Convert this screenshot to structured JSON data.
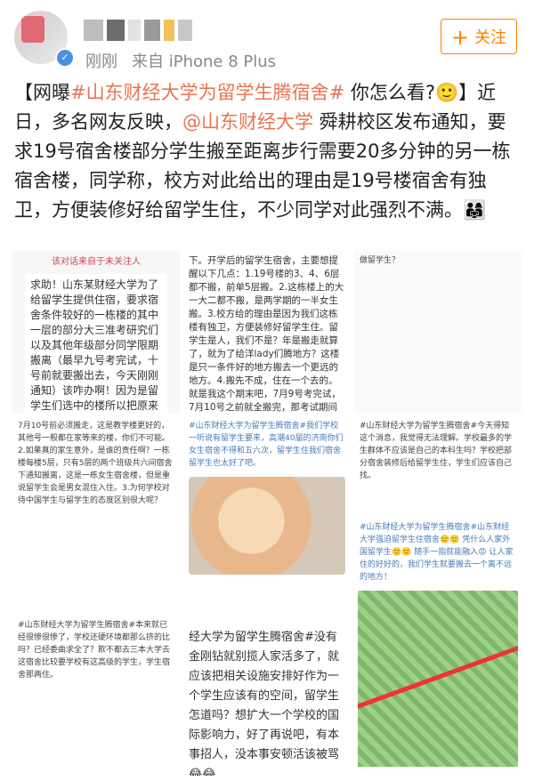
{
  "header": {
    "time": "刚刚",
    "source": "来自 iPhone 8 Plus",
    "follow_label": "关注"
  },
  "post": {
    "open": "【网曝",
    "topic": "#山东财经大学为留学生腾宿舍#",
    "question": " 你怎么看?🙂】近日，多名网友反映，",
    "mention": "@山东财经大学",
    "body": " 舜耕校区发布通知，要求19号宿舍楼部分学生搬至距离步行需要20多分钟的另一栋宿舍楼，同学称，校方对此给出的理由是19号楼宿舍有独卫，方便装修好给留学生住，不少同学对此强烈不满。👨‍👩‍👧"
  },
  "images": {
    "c1_head": "该对话来自于未关注人",
    "c1_notice": "求助！山东某财经大学为了给留学生提供住宿，要求宿舍条件较好的一栋楼的其中一层的部分大三准考研究们以及其他年级部分同学限期搬离（最早九号考完试，十号前就要搬出去，今天刚刚通知）该咋办啊！因为是留学生们选中的楼所以把原来住在好的好的考研究们就要去条件差的地方住吗?!",
    "c2_text": "下。开学后的留学生宿舍，主要想提醒以下几点：1.19号楼的3、4、6层都不搬，前单5层搬。2.这栋楼上的大一大二都不搬，是两学期的一半女生搬。3.校方给的理由是因为我们这栋楼有独卫，方便装修好留学生住。留学生是人，我们不是？年是搬走就算了，就为了给洋lady们腾地方？这楼是只一条件好的地方搬去一个更远的地方。4.搬先不成，住在一个去的。就是我这个期末吧，7月9号考完试，7月10号之前就全搬完，那考试期间的复习时间怎么保证？",
    "c3_text": "做留学生？",
    "c4_text": "7月10号前必须搬走，这是教学楼更好的，其他号一般都在家等来的楼，你们不可能。2.如果真的家生意外，是谁的责任啊？一栋楼每楼5层，只有5层的两个班级共六间宿舍下通知搬离，这是一栋女生宿舍楼，但是重说留学生会是男女混住入住。3.为何学校对待中国学生与留学生的态度区别很大呢？",
    "c5_text": "#山东财经大学为留学生腾宿舍#我们学校一听说有留学生要来，高潮40届的济南你们女生宿舍不得和五六次，留学生住我们宿舍留学生也太好了吧。",
    "c6_text": "#山东财经大学为留学生腾宿舍#今天得知这个消息，我觉得无法理解。学校最多的学生群体不应该是自己的本科生吗？学校把部分宿舍装修后给留学生住，学生们应该自己找。",
    "c7_text": "#山东财经大学为留学生腾宿舍#山东财经大学强迫留学生住宿舍🙂🙂 凭什么人家外国留学生🙂🙂 随手一指就能融入😡 让人家住的好好的，我们学生就要搬去一个离不远的地方！",
    "c8_text": "#山东财经大学为留学生腾宿舍#本来就已经很惨很惨了，学校还硬环境都那么挤的比吗？已经委曲求全了？欺不都去三本大学去这宿舍比较要学校有这高级的学生，学生宿舍那两住。",
    "c9_text": "经大学为留学生腾宿舍#没有金刚钻就别揽人家活多了，就应该把相关设施安排好作为一个学生应该有的空间，留学生怎道吗？想扩大一个学校的国际影响力，好了再说吧，有本事招人，没本事安顿活该被骂😂😂"
  },
  "colors": {
    "link": "#eb7350",
    "follow": "#ff8200",
    "verified": "#4a90e2"
  }
}
